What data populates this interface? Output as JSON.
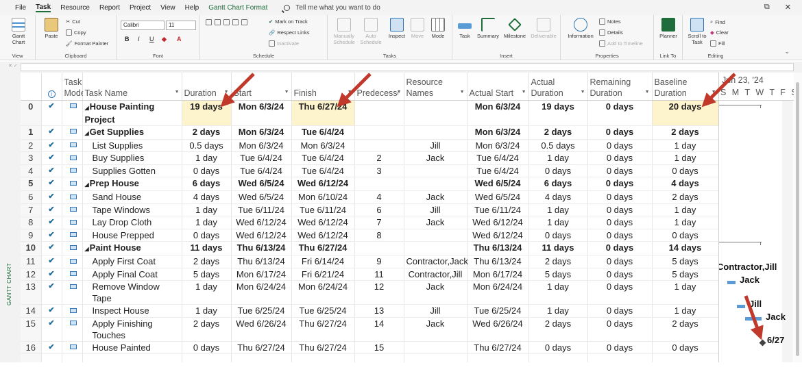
{
  "menu": {
    "items": [
      "File",
      "Task",
      "Resource",
      "Report",
      "Project",
      "View",
      "Help",
      "Gantt Chart Format"
    ],
    "active": "Task",
    "tell_me": "Tell me what you want to do"
  },
  "ribbon": {
    "view": {
      "gantt_chart": "Gantt Chart",
      "label": "View"
    },
    "clipboard": {
      "paste": "Paste",
      "cut": "Cut",
      "copy": "Copy",
      "format_painter": "Format Painter",
      "label": "Clipboard"
    },
    "font": {
      "font_name": "Calibri",
      "font_size": "11",
      "bold": "B",
      "italic": "I",
      "underline": "U",
      "label": "Font"
    },
    "schedule": {
      "mark_on_track": "Mark on Track",
      "respect_links": "Respect Links",
      "inactivate": "Inactivate",
      "label": "Schedule"
    },
    "tasks": {
      "manually_schedule": "Manually Schedule",
      "auto_schedule": "Auto Schedule",
      "inspect": "Inspect",
      "move": "Move",
      "mode": "Mode",
      "label": "Tasks"
    },
    "insert": {
      "task": "Task",
      "summary": "Summary",
      "milestone": "Milestone",
      "deliverable": "Deliverable",
      "label": "Insert"
    },
    "properties": {
      "information": "Information",
      "notes": "Notes",
      "details": "Details",
      "add_to_timeline": "Add to Timeline",
      "label": "Properties"
    },
    "link_to": {
      "planner": "Planner",
      "label": "Link To"
    },
    "editing": {
      "scroll_to_task": "Scroll to Task",
      "find": "Find",
      "clear": "Clear",
      "fill": "Fill",
      "label": "Editing"
    }
  },
  "side_label": "GANTT CHART",
  "columns": {
    "task_mode": "Task Mode",
    "task_name": "Task Name",
    "duration": "Duration",
    "start": "Start",
    "finish": "Finish",
    "predecessors": "Predecessors",
    "resource_names": "Resource Names",
    "actual_start": "Actual Start",
    "actual_duration": "Actual Duration",
    "remaining_duration": "Remaining Duration",
    "baseline_duration": "Baseline Duration"
  },
  "rows": [
    {
      "id": "0",
      "name": "House Painting Project",
      "duration": "19 days",
      "start": "Mon 6/3/24",
      "finish": "Thu 6/27/24",
      "pred": "",
      "res": "",
      "astart": "Mon 6/3/24",
      "adur": "19 days",
      "rdur": "0 days",
      "bdur": "20 days",
      "summary": true
    },
    {
      "id": "1",
      "name": "Get Supplies",
      "duration": "2 days",
      "start": "Mon 6/3/24",
      "finish": "Tue 6/4/24",
      "pred": "",
      "res": "",
      "astart": "Mon 6/3/24",
      "adur": "2 days",
      "rdur": "0 days",
      "bdur": "2 days",
      "summary": true
    },
    {
      "id": "2",
      "name": "List Supplies",
      "duration": "0.5 days",
      "start": "Mon 6/3/24",
      "finish": "Mon 6/3/24",
      "pred": "",
      "res": "Jill",
      "astart": "Mon 6/3/24",
      "adur": "0.5 days",
      "rdur": "0 days",
      "bdur": "1 day"
    },
    {
      "id": "3",
      "name": "Buy Supplies",
      "duration": "1 day",
      "start": "Tue 6/4/24",
      "finish": "Tue 6/4/24",
      "pred": "2",
      "res": "Jack",
      "astart": "Tue 6/4/24",
      "adur": "1 day",
      "rdur": "0 days",
      "bdur": "1 day"
    },
    {
      "id": "4",
      "name": "Supplies Gotten",
      "duration": "0 days",
      "start": "Tue 6/4/24",
      "finish": "Tue 6/4/24",
      "pred": "3",
      "res": "",
      "astart": "Tue 6/4/24",
      "adur": "0 days",
      "rdur": "0 days",
      "bdur": "0 days"
    },
    {
      "id": "5",
      "name": "Prep House",
      "duration": "6 days",
      "start": "Wed 6/5/24",
      "finish": "Wed 6/12/24",
      "pred": "",
      "res": "",
      "astart": "Wed 6/5/24",
      "adur": "6 days",
      "rdur": "0 days",
      "bdur": "4 days",
      "summary": true
    },
    {
      "id": "6",
      "name": "Sand House",
      "duration": "4 days",
      "start": "Wed 6/5/24",
      "finish": "Mon 6/10/24",
      "pred": "4",
      "res": "Jack",
      "astart": "Wed 6/5/24",
      "adur": "4 days",
      "rdur": "0 days",
      "bdur": "2 days"
    },
    {
      "id": "7",
      "name": "Tape Windows",
      "duration": "1 day",
      "start": "Tue 6/11/24",
      "finish": "Tue 6/11/24",
      "pred": "6",
      "res": "Jill",
      "astart": "Tue 6/11/24",
      "adur": "1 day",
      "rdur": "0 days",
      "bdur": "1 day"
    },
    {
      "id": "8",
      "name": "Lay Drop Cloth",
      "duration": "1 day",
      "start": "Wed 6/12/24",
      "finish": "Wed 6/12/24",
      "pred": "7",
      "res": "Jack",
      "astart": "Wed 6/12/24",
      "adur": "1 day",
      "rdur": "0 days",
      "bdur": "1 day"
    },
    {
      "id": "9",
      "name": "House Prepped",
      "duration": "0 days",
      "start": "Wed 6/12/24",
      "finish": "Wed 6/12/24",
      "pred": "8",
      "res": "",
      "astart": "Wed 6/12/24",
      "adur": "0 days",
      "rdur": "0 days",
      "bdur": "0 days"
    },
    {
      "id": "10",
      "name": "Paint House",
      "duration": "11 days",
      "start": "Thu 6/13/24",
      "finish": "Thu 6/27/24",
      "pred": "",
      "res": "",
      "astart": "Thu 6/13/24",
      "adur": "11 days",
      "rdur": "0 days",
      "bdur": "14 days",
      "summary": true
    },
    {
      "id": "11",
      "name": "Apply First Coat",
      "duration": "2 days",
      "start": "Thu 6/13/24",
      "finish": "Fri 6/14/24",
      "pred": "9",
      "res": "Contractor,Jack",
      "astart": "Thu 6/13/24",
      "adur": "2 days",
      "rdur": "0 days",
      "bdur": "5 days"
    },
    {
      "id": "12",
      "name": "Apply Final Coat",
      "duration": "5 days",
      "start": "Mon 6/17/24",
      "finish": "Fri 6/21/24",
      "pred": "11",
      "res": "Contractor,Jill",
      "astart": "Mon 6/17/24",
      "adur": "5 days",
      "rdur": "0 days",
      "bdur": "5 days"
    },
    {
      "id": "13",
      "name": "Remove Window Tape",
      "duration": "1 day",
      "start": "Mon 6/24/24",
      "finish": "Mon 6/24/24",
      "pred": "12",
      "res": "Jack",
      "astart": "Mon 6/24/24",
      "adur": "1 day",
      "rdur": "0 days",
      "bdur": "1 day"
    },
    {
      "id": "14",
      "name": "Inspect House",
      "duration": "1 day",
      "start": "Tue 6/25/24",
      "finish": "Tue 6/25/24",
      "pred": "13",
      "res": "Jill",
      "astart": "Tue 6/25/24",
      "adur": "1 day",
      "rdur": "0 days",
      "bdur": "1 day"
    },
    {
      "id": "15",
      "name": "Apply Finishing Touches",
      "duration": "2 days",
      "start": "Wed 6/26/24",
      "finish": "Thu 6/27/24",
      "pred": "14",
      "res": "Jack",
      "astart": "Wed 6/26/24",
      "adur": "2 days",
      "rdur": "0 days",
      "bdur": "2 days"
    },
    {
      "id": "16",
      "name": "House Painted",
      "duration": "0 days",
      "start": "Thu 6/27/24",
      "finish": "Thu 6/27/24",
      "pred": "15",
      "res": "",
      "astart": "Thu 6/27/24",
      "adur": "0 days",
      "rdur": "0 days",
      "bdur": "0 days"
    }
  ],
  "gantt": {
    "week_label": "Jun 23, '24",
    "days": "S M T W T F S S",
    "labels": [
      "Contractor,Jill",
      "Jack",
      "Jill",
      "Jack",
      "6/27"
    ]
  },
  "colors": {
    "highlight": "#fdf3cd",
    "accent": "#1f6d3b",
    "arrow": "#c0392b",
    "bar": "#5b9bd5"
  }
}
